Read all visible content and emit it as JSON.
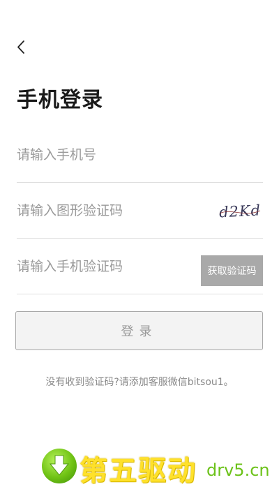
{
  "header": {
    "back_icon": "chevron-left-icon",
    "title": "手机登录"
  },
  "form": {
    "phone_placeholder": "请输入手机号",
    "phone_value": "",
    "captcha_placeholder": "请输入图形验证码",
    "captcha_value": "",
    "captcha_image_text": "d2Kd",
    "sms_placeholder": "请输入手机验证码",
    "sms_value": "",
    "sms_button_label": "获取验证码",
    "login_button_label": "登录"
  },
  "help": {
    "text": "没有收到验证码?请添加客服微信bitsou1。"
  },
  "watermark": {
    "title": "第五驱动",
    "domain": "drv5.cn",
    "icon": "download-arrow-icon"
  },
  "colors": {
    "sms_button_bg": "#a9a9a9",
    "login_button_bg": "#f3f3f3",
    "watermark_yellow": "#ffe12a",
    "watermark_green": "#6cc21a"
  }
}
